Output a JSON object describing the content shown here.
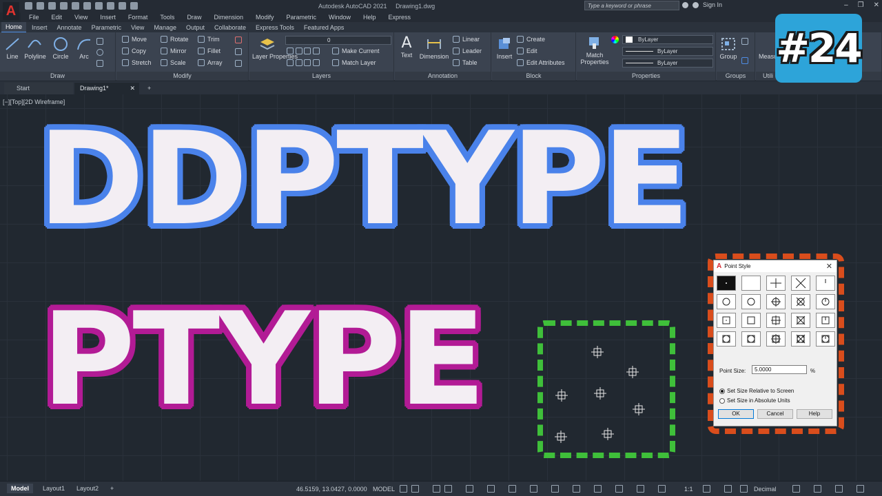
{
  "app": {
    "logo": "A",
    "product": "Autodesk AutoCAD 2021",
    "document": "Drawing1.dwg",
    "search_placeholder": "Type a keyword or phrase",
    "sign_in": "Sign In"
  },
  "menu": [
    "File",
    "Edit",
    "View",
    "Insert",
    "Format",
    "Tools",
    "Draw",
    "Dimension",
    "Modify",
    "Parametric",
    "Window",
    "Help",
    "Express"
  ],
  "ribbon_tabs": [
    "Home",
    "Insert",
    "Annotate",
    "Parametric",
    "View",
    "Manage",
    "Output",
    "Collaborate",
    "Express Tools",
    "Featured Apps"
  ],
  "ribbon": {
    "draw": {
      "title": "Draw",
      "line": "Line",
      "polyline": "Polyline",
      "circle": "Circle",
      "arc": "Arc"
    },
    "modify": {
      "title": "Modify",
      "move": "Move",
      "rotate": "Rotate",
      "trim": "Trim",
      "copy": "Copy",
      "mirror": "Mirror",
      "fillet": "Fillet",
      "stretch": "Stretch",
      "scale": "Scale",
      "array": "Array"
    },
    "layers": {
      "title": "Layers",
      "layer_properties": "Layer Properties",
      "layer_value": "0",
      "make_current": "Make Current",
      "match_layer": "Match Layer"
    },
    "annotation": {
      "title": "Annotation",
      "text": "Text",
      "dimension": "Dimension",
      "linear": "Linear",
      "leader": "Leader",
      "table": "Table"
    },
    "block": {
      "title": "Block",
      "insert": "Insert",
      "create": "Create",
      "edit": "Edit",
      "edit_attributes": "Edit Attributes"
    },
    "properties": {
      "title": "Properties",
      "match_properties": "Match Properties",
      "color": "ByLayer",
      "linetype": "ByLayer",
      "lineweight": "ByLayer"
    },
    "groups": {
      "title": "Groups",
      "group": "Group"
    },
    "utilities": {
      "title": "Utili",
      "measure": "Measu"
    }
  },
  "badge": "#24",
  "file_tabs": {
    "start": "Start",
    "drawing": "Drawing1*",
    "add": "+"
  },
  "viewport_label": "[−][Top][2D Wireframe]",
  "headline1": "DDPTYPE",
  "headline2": "PTYPE",
  "dialog": {
    "logo": "A",
    "title": "Point Style",
    "close": "✕",
    "point_size_label": "Point Size:",
    "point_size_value": "5.0000",
    "unit": "%",
    "radio_relative": "Set Size Relative to Screen",
    "radio_absolute": "Set Size in Absolute Units",
    "ok": "OK",
    "cancel": "Cancel",
    "help": "Help"
  },
  "status": {
    "model_tab": "Model",
    "layout1": "Layout1",
    "layout2": "Layout2",
    "add": "+",
    "coordinates": "46.5159, 13.0427, 0.0000",
    "mode": "MODEL",
    "scale": "1:1",
    "units": "Decimal"
  },
  "colors": {
    "headline1_outline": "#4a82ea",
    "headline2_outline": "#b21b95",
    "green_box": "#3fbf3a",
    "red_box": "#d94d1c",
    "badge": "#2da4d9"
  }
}
